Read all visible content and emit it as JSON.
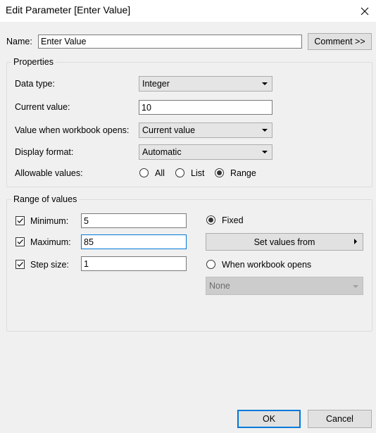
{
  "window": {
    "title": "Edit Parameter [Enter Value]"
  },
  "name_row": {
    "label": "Name:",
    "value": "Enter Value",
    "comment_button": "Comment >>"
  },
  "properties": {
    "group_title": "Properties",
    "data_type_label": "Data type:",
    "data_type_value": "Integer",
    "current_value_label": "Current value:",
    "current_value": "10",
    "workbook_opens_label": "Value when workbook opens:",
    "workbook_opens_value": "Current value",
    "display_format_label": "Display format:",
    "display_format_value": "Automatic",
    "allowable_label": "Allowable values:",
    "allowable_options": [
      "All",
      "List",
      "Range"
    ],
    "allowable_selected": "Range"
  },
  "range": {
    "group_title": "Range of values",
    "minimum_label": "Minimum:",
    "minimum_value": "5",
    "minimum_checked": true,
    "maximum_label": "Maximum:",
    "maximum_value": "85",
    "maximum_checked": true,
    "step_label": "Step size:",
    "step_value": "1",
    "step_checked": true,
    "fixed_label": "Fixed",
    "set_values_from": "Set values from",
    "when_workbook_opens_label": "When workbook opens",
    "when_workbook_opens_value": "None",
    "selected_mode": "Fixed"
  },
  "footer": {
    "ok": "OK",
    "cancel": "Cancel"
  },
  "colors": {
    "accent": "#0078d7",
    "background": "#f0f0f0"
  }
}
